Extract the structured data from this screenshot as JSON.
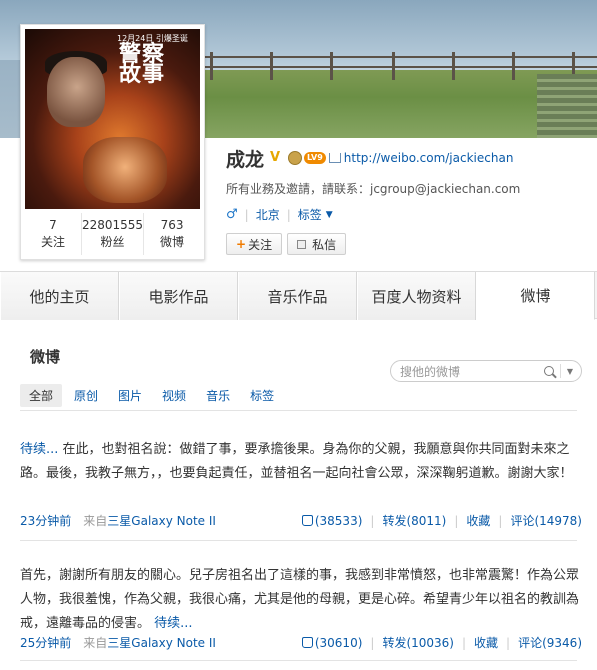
{
  "profile": {
    "name": "成龙",
    "level": "LV9",
    "url": "http://weibo.com/jackiechan",
    "business": "所有业務及邀請，請联系：jcgroup@jackiechan.com",
    "gender_symbol": "♂",
    "location": "北京",
    "tags_label": "标签",
    "follow_button": "关注",
    "message_button": "私信",
    "poster": {
      "date": "12月24日 引爆圣诞",
      "title": "警察\n故事"
    },
    "stats": [
      {
        "count": "7",
        "label": "关注"
      },
      {
        "count": "22801555",
        "label": "粉丝"
      },
      {
        "count": "763",
        "label": "微博"
      }
    ]
  },
  "tabs": [
    {
      "label": "他的主页"
    },
    {
      "label": "电影作品"
    },
    {
      "label": "音乐作品"
    },
    {
      "label": "百度人物资料"
    },
    {
      "label": "微博",
      "active": true
    }
  ],
  "feed": {
    "title": "微博",
    "search_placeholder": "搜他的微博",
    "filters": [
      "全部",
      "原创",
      "图片",
      "视频",
      "音乐",
      "标签"
    ],
    "posts": [
      {
        "lead": "待续",
        "lead_suffix": "...",
        "text": " 在此，也對祖名說：做錯了事，要承擔後果。身為你的父親，我願意與你共同面對未來之路。最後，我教子無方，，也要負起責任，並替祖名一起向社會公眾，深深鞠躬道歉。謝謝大家！",
        "time": "23分钟前",
        "source_prefix": "来自",
        "source": "三星Galaxy Note II",
        "likes": "(38533)",
        "repost": "转发(8011)",
        "favorite": "收藏",
        "comment": "评论(14978)"
      },
      {
        "text": "首先，謝謝所有朋友的關心。兒子房祖名出了這樣的事，我感到非常憤怒，也非常震驚！作為公眾人物，我很羞愧，作為父親，我很心痛，尤其是他的母親，更是心碎。希望青少年以祖名的教訓為戒，遠離毒品的侵害。",
        "trail": " 待续",
        "trail_suffix": "...",
        "time": "25分钟前",
        "source_prefix": "来自",
        "source": "三星Galaxy Note II",
        "likes": "(30610)",
        "repost": "转发(10036)",
        "favorite": "收藏",
        "comment": "评论(9346)"
      }
    ]
  },
  "colors": {
    "link": "#0a5aa8",
    "level_badge": "#f08a00",
    "follow_plus": "#f07b00"
  }
}
